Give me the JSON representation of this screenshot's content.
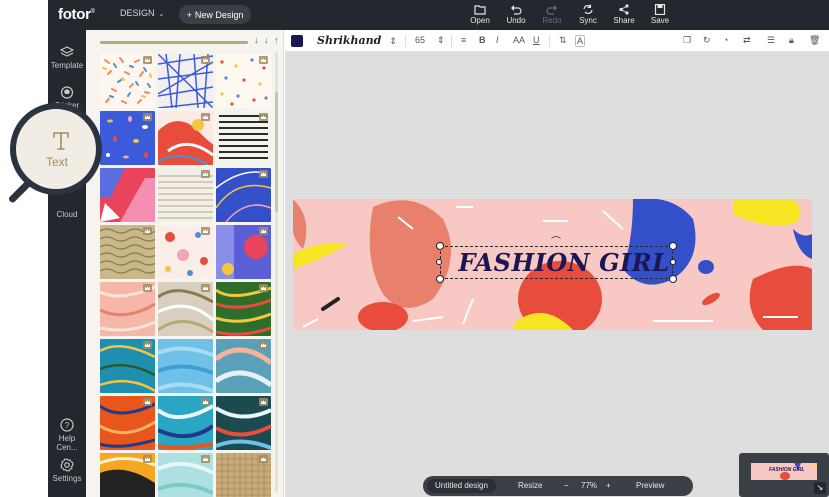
{
  "app": {
    "logo": "fotor",
    "design_menu": "DESIGN",
    "new_design": "New Design"
  },
  "toolbar": {
    "open": "Open",
    "undo": "Undo",
    "redo": "Redo",
    "sync": "Sync",
    "share": "Share",
    "save": "Save"
  },
  "rail": {
    "template": "Template",
    "sticker": "Sticker",
    "text": "Text",
    "cloud": "Cloud",
    "help": "Help Cen...",
    "settings": "Settings"
  },
  "format": {
    "color": "#1a1752",
    "font": "Shrikhand",
    "size": "65"
  },
  "canvas": {
    "headline": "FASHION GIRL",
    "background": "#f8c8c4"
  },
  "bottom": {
    "design_name": "Untitled design",
    "resize": "Resize",
    "zoom_out": "−",
    "zoom": "77%",
    "zoom_in": "+",
    "preview": "Preview"
  },
  "minimap": {
    "toggle": "↘"
  },
  "colors": {
    "topbar": "#23272e",
    "accent": "#a48d58",
    "text_color": "#1a1752"
  }
}
